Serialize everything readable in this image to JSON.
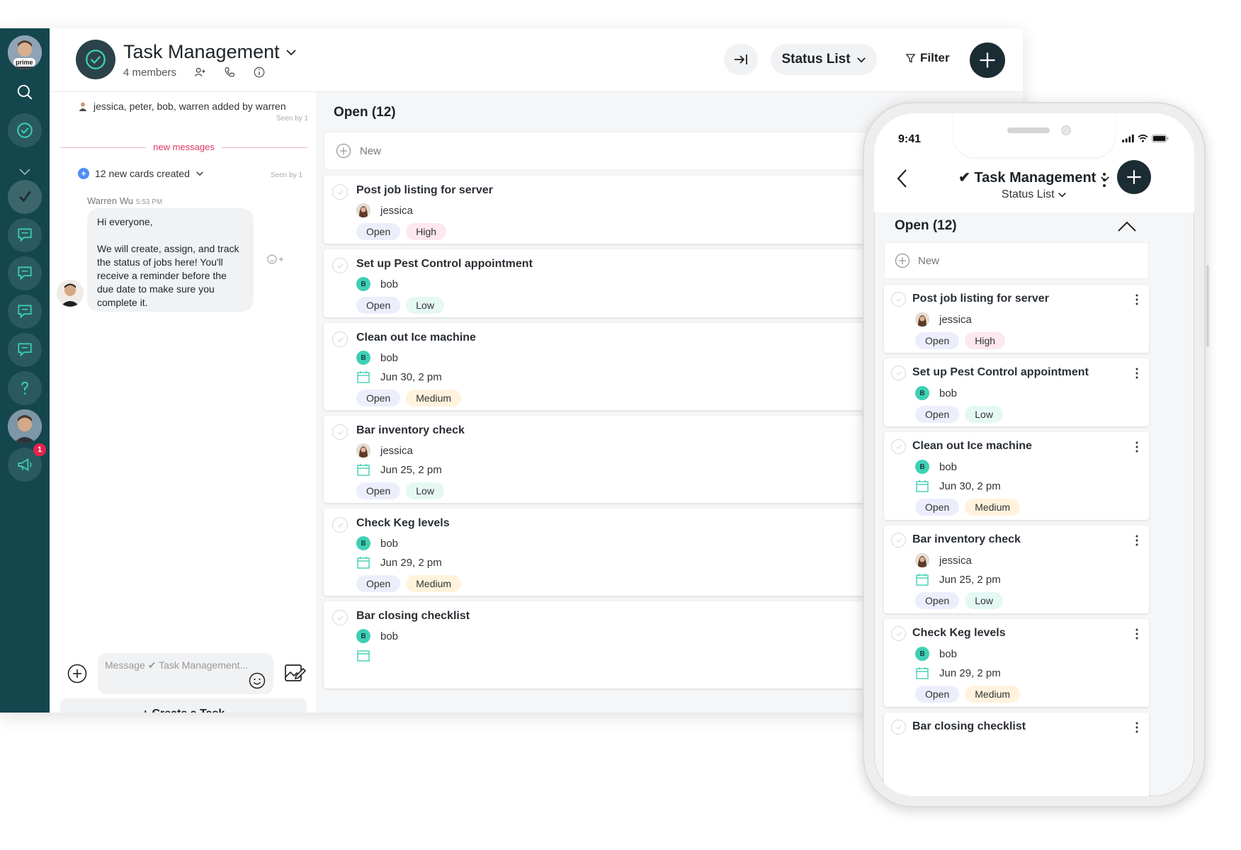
{
  "colors": {
    "rail": "#14464e",
    "accent": "#3fd0b5",
    "dark_button": "#1c2c33",
    "badge": "#e8224d"
  },
  "rail": {
    "prime_label": "prime",
    "badge_count": "1"
  },
  "header": {
    "title": "Task Management",
    "members": "4 members",
    "status_button": "Status List",
    "filter_button": "Filter"
  },
  "chat": {
    "system_message": "jessica, peter, bob, warren added by warren",
    "seen_1": "Seen by 1",
    "new_messages_divider": "new messages",
    "cards_created": "12 new cards created",
    "seen_2": "Seen by 1",
    "author": "Warren Wu",
    "time": "5:53 PM",
    "message": "Hi everyone,\n\nWe will create, assign, and track the status of jobs here! You'll receive a reminder before the due date to make sure you complete it.",
    "compose_placeholder": "Message ✔ Task Management...",
    "create_task": "+ Create a Task"
  },
  "board": {
    "column_title": "Open (12)",
    "new_label": "New",
    "tasks": [
      {
        "title": "Post job listing for server",
        "assignee": "jessica",
        "assignee_type": "photo",
        "due": "",
        "status": "Open",
        "priority": "High"
      },
      {
        "title": "Set up Pest Control appointment",
        "assignee": "bob",
        "assignee_type": "initial",
        "assignee_initial": "B",
        "due": "",
        "status": "Open",
        "priority": "Low"
      },
      {
        "title": "Clean out Ice machine",
        "assignee": "bob",
        "assignee_type": "initial",
        "assignee_initial": "B",
        "due": "Jun 30, 2 pm",
        "status": "Open",
        "priority": "Medium"
      },
      {
        "title": "Bar inventory check",
        "assignee": "jessica",
        "assignee_type": "photo",
        "due": "Jun 25, 2 pm",
        "status": "Open",
        "priority": "Low"
      },
      {
        "title": "Check Keg levels",
        "assignee": "bob",
        "assignee_type": "initial",
        "assignee_initial": "B",
        "due": "Jun 29, 2 pm",
        "status": "Open",
        "priority": "Medium"
      },
      {
        "title": "Bar closing checklist",
        "assignee": "bob",
        "assignee_type": "initial",
        "assignee_initial": "B",
        "due": "",
        "status": "",
        "priority": ""
      }
    ]
  },
  "phone": {
    "time": "9:41",
    "title": "✔ Task Management",
    "subtitle": "Status List",
    "column_title": "Open (12)",
    "new_label": "New"
  }
}
